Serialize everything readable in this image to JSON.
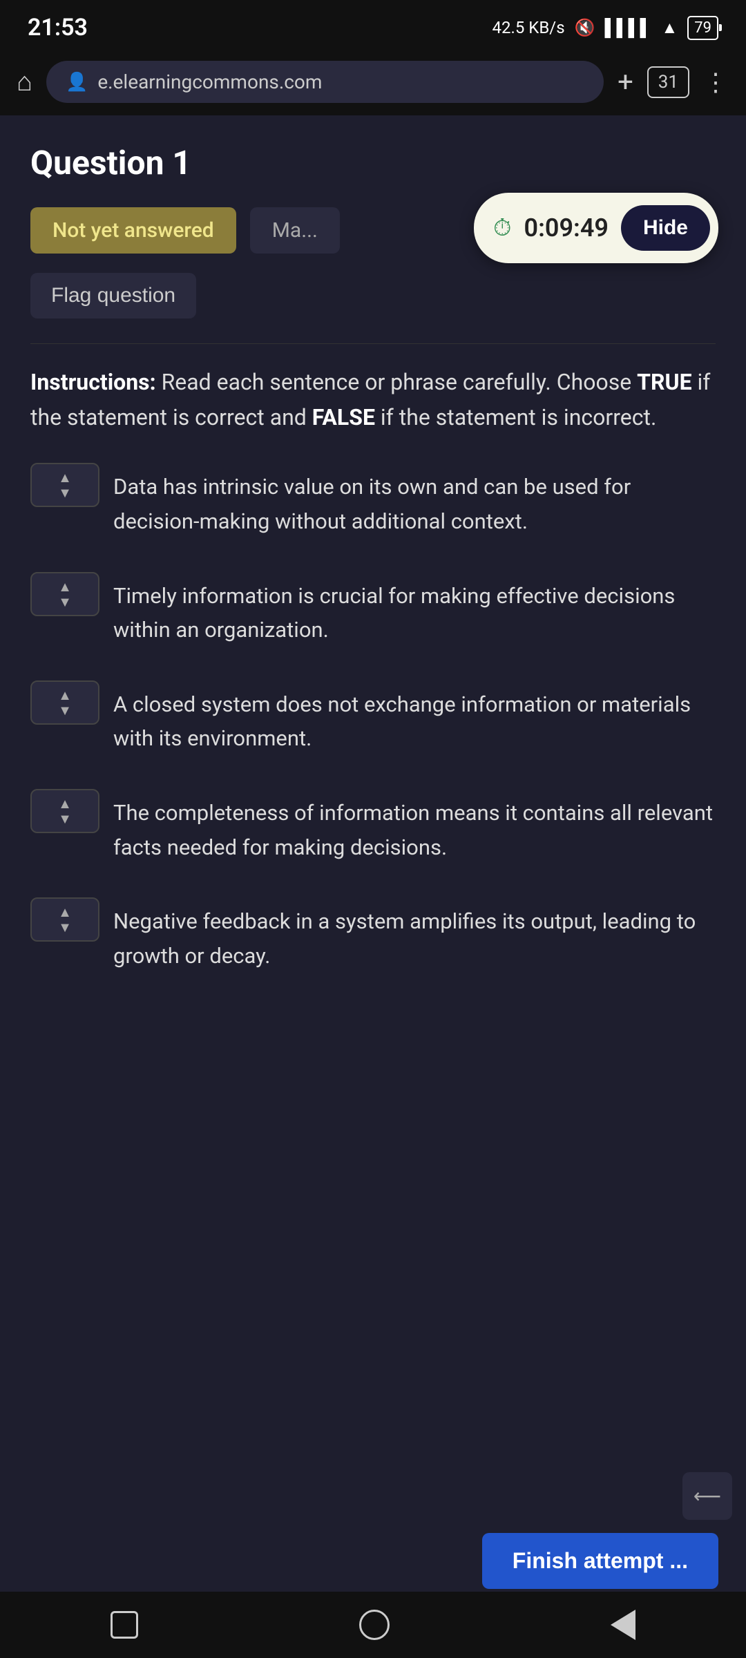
{
  "statusBar": {
    "time": "21:53",
    "speed": "42.5 KB/s",
    "battery": "79"
  },
  "browser": {
    "url": "e.elearningcommons.com",
    "tabCount": "31"
  },
  "question": {
    "title": "Question 1",
    "statusBadge": "Not yet answered",
    "marksBadge": "Ma...",
    "flagButton": "Flag question",
    "timer": "0:09:49",
    "hideButton": "Hide"
  },
  "instructions": {
    "prefix": "Instructions:",
    "body": " Read each sentence or phrase carefully. Choose ",
    "trueWord": "TRUE",
    "mid": " if the statement is correct and ",
    "falseWord": "FALSE",
    "end": " if the statement is incorrect."
  },
  "items": [
    {
      "id": 1,
      "text": "Data has intrinsic value on its own and can be used for decision-making without additional context."
    },
    {
      "id": 2,
      "text": "Timely information is crucial for making effective decisions within an organization."
    },
    {
      "id": 3,
      "text": "A closed system does not exchange information or materials with its environment."
    },
    {
      "id": 4,
      "text": "The completeness of information means it contains all relevant facts needed for making decisions."
    },
    {
      "id": 5,
      "text": "Negative feedback in a system amplifies its output, leading to growth or decay."
    }
  ],
  "finishButton": "Finish attempt ...",
  "scrollButtonIcon": "⟵"
}
